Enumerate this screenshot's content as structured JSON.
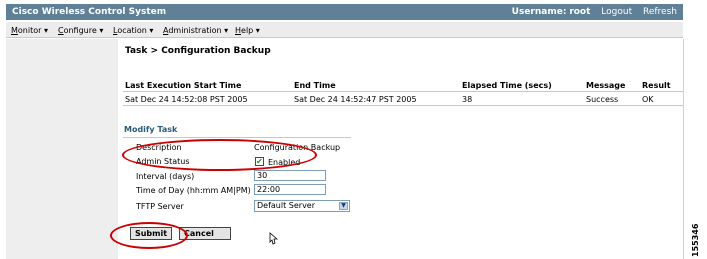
{
  "header": {
    "app_title": "Cisco Wireless Control System",
    "username_label": "Username:",
    "username": "root",
    "logout": "Logout",
    "refresh": "Refresh"
  },
  "menu": [
    {
      "label": "Monitor",
      "accel": "M",
      "rest": "onitor"
    },
    {
      "label": "Configure",
      "accel": "C",
      "rest": "onfigure"
    },
    {
      "label": "Location",
      "accel": "L",
      "rest": "ocation"
    },
    {
      "label": "Administration",
      "accel": "A",
      "rest": "dministration"
    },
    {
      "label": "Help",
      "accel": "H",
      "rest": "elp"
    }
  ],
  "page": {
    "title": "Task > Configuration Backup"
  },
  "results": {
    "headers": [
      "Last Execution Start Time",
      "End Time",
      "Elapsed Time (secs)",
      "Message",
      "Result"
    ],
    "row": [
      "Sat Dec 24 14:52:08 PST 2005",
      "Sat Dec 24 14:52:47 PST 2005",
      "38",
      "Success",
      "OK"
    ]
  },
  "modify_task": {
    "section_title": "Modify Task",
    "description_label": "Description",
    "description_value": "Configuration Backup",
    "admin_status_label": "Admin Status",
    "admin_status_checked": true,
    "admin_status_text": "Enabled",
    "interval_label": "Interval (days)",
    "interval_value": "30",
    "time_label": "Time of Day (hh:mm AM|PM)",
    "time_value": "22:00",
    "tftp_label": "TFTP Server",
    "tftp_value": "Default Server"
  },
  "buttons": {
    "submit": "Submit",
    "cancel": "Cancel"
  },
  "figure_number": "155346",
  "icons": {
    "dropdown": "triangle-down",
    "checkmark": "check",
    "cursor": "hand-pointer"
  },
  "colors": {
    "title_bar": "#5f8097",
    "section_title": "#2b5b76",
    "annotation": "#cc0000"
  }
}
